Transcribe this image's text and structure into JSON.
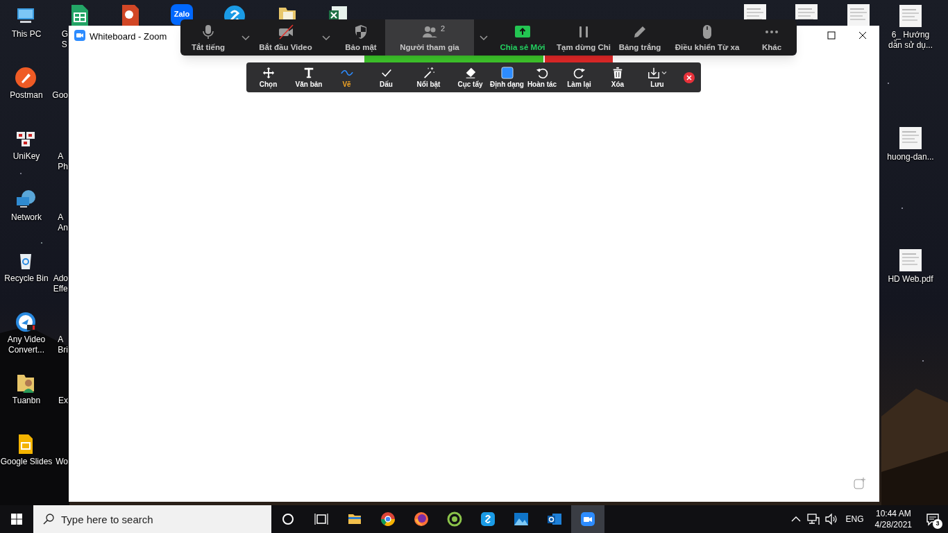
{
  "desktop": {
    "left_icons": [
      {
        "label": "This PC"
      },
      {
        "label": "Postman"
      },
      {
        "label": "UniKey"
      },
      {
        "label": "Network"
      },
      {
        "label": "Recycle Bin"
      },
      {
        "label": "Any Video\nConvert..."
      },
      {
        "label": "Tuanbn"
      },
      {
        "label": "Google Slides"
      }
    ],
    "second_column_labels": [
      "G\nS",
      "Goo",
      "A\nPh",
      "A\nAn",
      "Ado\nEffe",
      "A\nBri",
      "Ex",
      "Wo"
    ],
    "zalo_logo": "Zalo",
    "right_icons": [
      {
        "label": "6_ Hướng\ndẫn sử dụ..."
      },
      {
        "label": "huong-dan..."
      },
      {
        "label": "HD Web.pdf"
      }
    ]
  },
  "whiteboard_window": {
    "title": "Whiteboard - Zoom"
  },
  "meeting_toolbar": {
    "items": [
      {
        "kind": "button",
        "label": "Tắt tiếng",
        "highlighted": false
      },
      {
        "kind": "dropdown"
      },
      {
        "kind": "button",
        "label": "Bắt đầu Video",
        "highlighted": false
      },
      {
        "kind": "dropdown"
      },
      {
        "kind": "button",
        "label": "Bảo mật",
        "highlighted": false
      },
      {
        "kind": "button",
        "label": "Người tham gia",
        "badge": "2",
        "highlighted": true
      },
      {
        "kind": "dropdown"
      },
      {
        "kind": "share",
        "label": "Chia sẻ Mới",
        "highlighted": false
      },
      {
        "kind": "button",
        "label": "Tạm dừng Chi",
        "highlighted": false
      },
      {
        "kind": "button",
        "label": "Bảng trắng",
        "highlighted": false
      },
      {
        "kind": "button",
        "label": "Điều khiển Từ xa",
        "highlighted": false
      },
      {
        "kind": "button",
        "label": "Khác",
        "highlighted": false
      }
    ]
  },
  "annotation_toolbar": {
    "tools": [
      {
        "label": "Chọn",
        "selected": false
      },
      {
        "label": "Văn bản",
        "selected": false
      },
      {
        "label": "Vẽ",
        "selected": true
      },
      {
        "label": "Dấu",
        "selected": false
      },
      {
        "label": "Nổi bật",
        "selected": false
      },
      {
        "label": "Cục tẩy",
        "selected": false
      },
      {
        "label": "Định dạng",
        "selected": false
      },
      {
        "label": "Hoàn tác",
        "selected": false
      },
      {
        "label": "Làm lại",
        "selected": false
      },
      {
        "label": "Xóa",
        "selected": false
      },
      {
        "label": "Lưu",
        "selected": false,
        "has_menu": true
      }
    ]
  },
  "taskbar": {
    "search_placeholder": "Type here to search",
    "apps": [
      {
        "active": false
      },
      {
        "active": false
      },
      {
        "active": false
      },
      {
        "active": false
      },
      {
        "active": false
      },
      {
        "active": false
      },
      {
        "active": false
      },
      {
        "active": true
      }
    ],
    "language": "ENG",
    "time": "10:44 AM",
    "date": "4/28/2021",
    "notification_count": "3"
  }
}
